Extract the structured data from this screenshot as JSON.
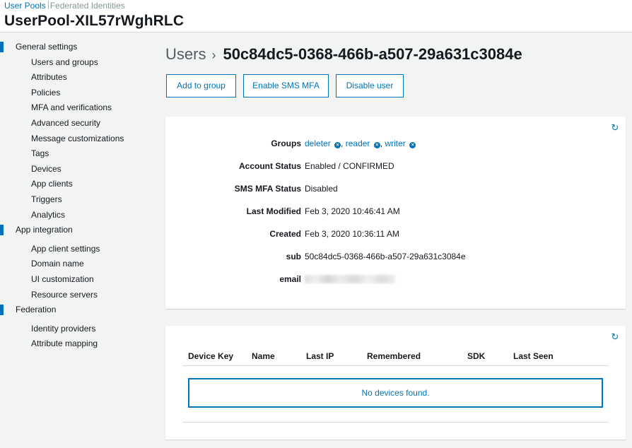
{
  "header": {
    "crumb_user_pools": "User Pools",
    "crumb_federated": "Federated Identities",
    "pool_name": "UserPool-XIL57rWghRLC"
  },
  "sidebar": {
    "sections": [
      {
        "label": "General settings",
        "items": [
          "Users and groups",
          "Attributes",
          "Policies",
          "MFA and verifications",
          "Advanced security",
          "Message customizations",
          "Tags",
          "Devices",
          "App clients",
          "Triggers",
          "Analytics"
        ]
      },
      {
        "label": "App integration",
        "items": [
          "App client settings",
          "Domain name",
          "UI customization",
          "Resource servers"
        ]
      },
      {
        "label": "Federation",
        "items": [
          "Identity providers",
          "Attribute mapping"
        ]
      }
    ]
  },
  "page": {
    "title_prefix": "Users",
    "user_id": "50c84dc5-0368-466b-a507-29a631c3084e"
  },
  "actions": {
    "add_to_group": "Add to group",
    "enable_sms_mfa": "Enable SMS MFA",
    "disable_user": "Disable user"
  },
  "details": {
    "groups_label": "Groups",
    "groups": [
      "deleter",
      "reader",
      "writer"
    ],
    "account_status_label": "Account Status",
    "account_status": "Enabled / CONFIRMED",
    "sms_mfa_label": "SMS MFA Status",
    "sms_mfa": "Disabled",
    "last_modified_label": "Last Modified",
    "last_modified": "Feb 3, 2020 10:46:41 AM",
    "created_label": "Created",
    "created": "Feb 3, 2020 10:36:11 AM",
    "sub_label": "sub",
    "sub": "50c84dc5-0368-466b-a507-29a631c3084e",
    "email_label": "email"
  },
  "devices": {
    "columns": [
      "Device Key",
      "Name",
      "Last IP",
      "Remembered",
      "SDK",
      "Last Seen"
    ],
    "empty_message": "No devices found."
  },
  "colors": {
    "accent": "#0073bb",
    "background": "#f2f3f3"
  },
  "icons": {
    "refresh": "refresh-icon",
    "remove_group": "remove-circle-icon",
    "chevron": "chevron-right-icon"
  }
}
